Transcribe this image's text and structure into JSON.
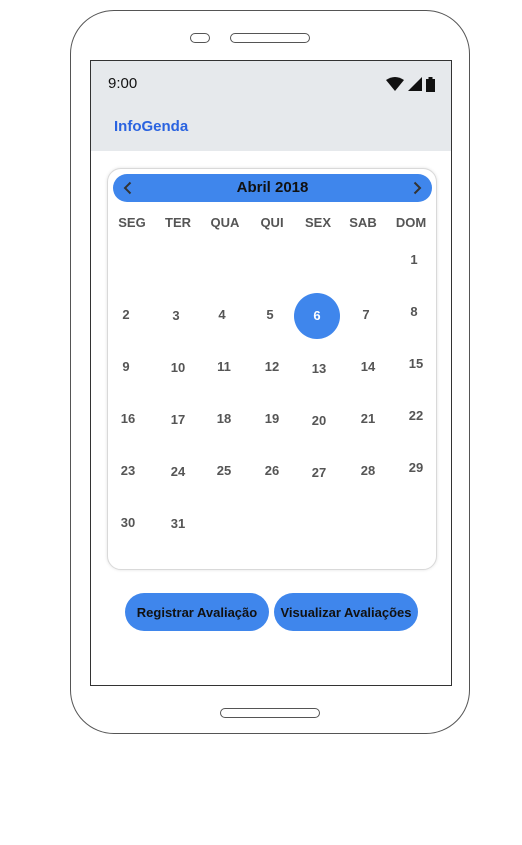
{
  "status_bar": {
    "time": "9:00"
  },
  "app": {
    "title": "InfoGenda"
  },
  "calendar": {
    "month_label": "Abril 2018",
    "weekdays": [
      "SEG",
      "TER",
      "QUA",
      "QUI",
      "SEX",
      "SAB",
      "DOM"
    ],
    "days": [
      "1",
      "2",
      "3",
      "4",
      "5",
      "6",
      "7",
      "8",
      "9",
      "10",
      "11",
      "12",
      "13",
      "14",
      "15",
      "16",
      "17",
      "18",
      "19",
      "20",
      "21",
      "22",
      "23",
      "24",
      "25",
      "26",
      "27",
      "28",
      "29",
      "30",
      "31"
    ],
    "selected_day": "6"
  },
  "actions": {
    "register_label": "Registrar Avaliação",
    "view_label": "Visualizar Avaliações"
  },
  "colors": {
    "accent": "#3f86ec",
    "title": "#2a63e0",
    "topbar": "#e6e9ec"
  },
  "icons": [
    "prev-month-chevron-icon",
    "next-month-chevron-icon",
    "wifi-icon",
    "cellular-signal-icon",
    "battery-icon"
  ]
}
